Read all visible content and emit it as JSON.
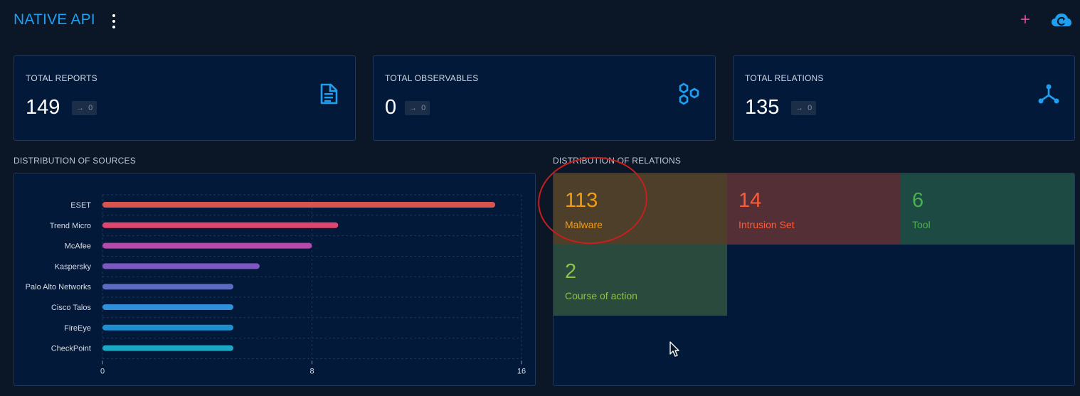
{
  "header": {
    "title": "NATIVE API",
    "menu_icon": "more-vert-icon",
    "add_icon": "plus-icon",
    "add_glyph": "+",
    "cloud_icon": "cloud-refresh-icon"
  },
  "stats": [
    {
      "label": "TOTAL REPORTS",
      "value": "149",
      "delta": "0",
      "icon": "report-document-icon"
    },
    {
      "label": "TOTAL OBSERVABLES",
      "value": "0",
      "delta": "0",
      "icon": "hexagons-icon"
    },
    {
      "label": "TOTAL RELATIONS",
      "value": "135",
      "delta": "0",
      "icon": "relations-graph-icon"
    }
  ],
  "colors": {
    "accent": "#1ea0f2",
    "background": "#0b1626",
    "card": "#02193a"
  },
  "sources": {
    "title": "DISTRIBUTION OF SOURCES"
  },
  "chart_data": {
    "type": "bar",
    "orientation": "horizontal",
    "categories": [
      "ESET",
      "Trend Micro",
      "McAfee",
      "Kaspersky",
      "Palo Alto Networks",
      "Cisco Talos",
      "FireEye",
      "CheckPoint"
    ],
    "values": [
      15,
      9,
      8,
      6,
      5,
      5,
      5,
      5
    ],
    "colors": [
      "#d9534f",
      "#e0456d",
      "#b44aa9",
      "#7e57c2",
      "#5c6bc0",
      "#2f8fdb",
      "#1d8ed0",
      "#19a9c4"
    ],
    "xlim": [
      0,
      16
    ],
    "xticks": [
      "0",
      "8",
      "16"
    ],
    "grid": true
  },
  "relations": {
    "title": "DISTRIBUTION OF RELATIONS",
    "tiles": [
      {
        "value": "113",
        "label": "Malware",
        "bg": "#4e3f2b",
        "fg": "#f39c12"
      },
      {
        "value": "14",
        "label": "Intrusion Set",
        "bg": "#552f36",
        "fg": "#ff5a36"
      },
      {
        "value": "6",
        "label": "Tool",
        "bg": "#1e4a44",
        "fg": "#4caf50"
      },
      {
        "value": "2",
        "label": "Course of action",
        "bg": "#2a4a3d",
        "fg": "#8bc34a"
      }
    ]
  }
}
